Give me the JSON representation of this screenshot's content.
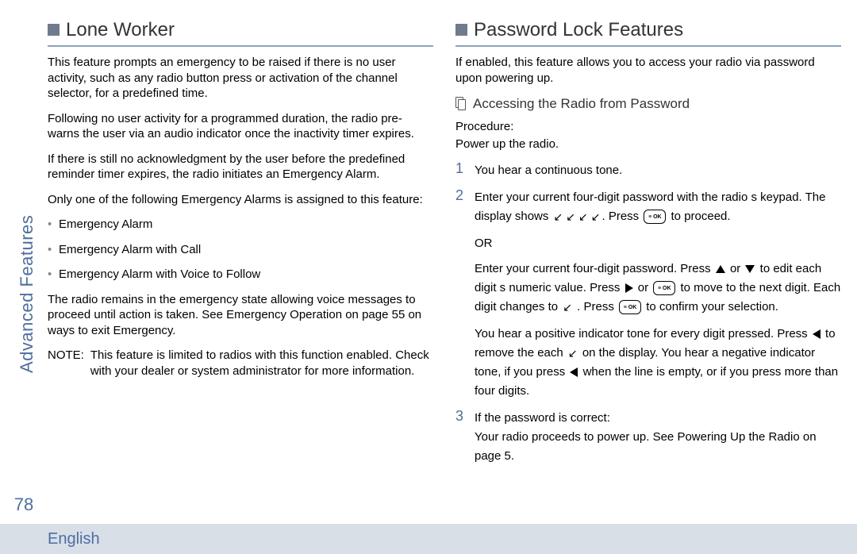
{
  "sidebar": {
    "section_label": "Advanced Features",
    "page_number": "78"
  },
  "footer": {
    "language": "English"
  },
  "left": {
    "heading": "Lone Worker",
    "p1": "This feature prompts an emergency to be raised if there is no user activity, such as any radio button press or activation of the channel selector, for a predefined time.",
    "p2": "Following no user activity for a programmed duration, the radio pre-warns the user via an audio indicator once the inactivity timer expires.",
    "p3": "If there is still no acknowledgment by the user before the predefined reminder timer expires, the radio initiates an Emergency Alarm.",
    "p4": "Only one of the following Emergency Alarms is assigned to this feature:",
    "bullets": {
      "b1": "Emergency Alarm",
      "b2": "Emergency Alarm with Call",
      "b3": "Emergency Alarm with Voice to Follow"
    },
    "p5": "The radio remains in the emergency state allowing voice messages to proceed until action is taken. See Emergency Operation  on page 55 on ways to exit Emergency.",
    "note_label": "NOTE:",
    "note_text": "This feature is limited to radios with this function enabled. Check with your dealer or system administrator for more information."
  },
  "right": {
    "heading": "Password Lock Features",
    "p1": "If enabled, this feature allows you to access your radio via password upon powering up.",
    "sub_heading": "Accessing the Radio from Password",
    "procedure_label": "Procedure:",
    "power_up": "Power up the radio.",
    "steps": {
      "one": {
        "num": "1",
        "text": "You hear a continuous tone."
      },
      "two": {
        "num": "2",
        "a1": "Enter your current four-digit password with the radio s keypad. The display shows ",
        "a2": ". Press ",
        "a3": " to proceed.",
        "or": "OR",
        "b1": "Enter your current four-digit password. Press ",
        "b2": " or ",
        "b3": " to edit each digit s numeric value. Press ",
        "b4": " or ",
        "b5": " to move to the next digit. Each digit changes to  ",
        "b6": ". Press ",
        "b7": " to confirm your selection.",
        "c1": "You hear a positive indicator tone for every digit pressed. Press ",
        "c2": " to remove the each  ",
        "c3": " on the display. You hear a negative indicator tone, if you press ",
        "c4": " when the line is empty, or if you press more than four digits."
      },
      "three": {
        "num": "3",
        "text": "If the password is correct:\nYour radio proceeds to power up. See Powering Up the Radio  on page 5."
      }
    },
    "ok_glyph": "≡\nOK",
    "arrow_glyph": "↙"
  }
}
